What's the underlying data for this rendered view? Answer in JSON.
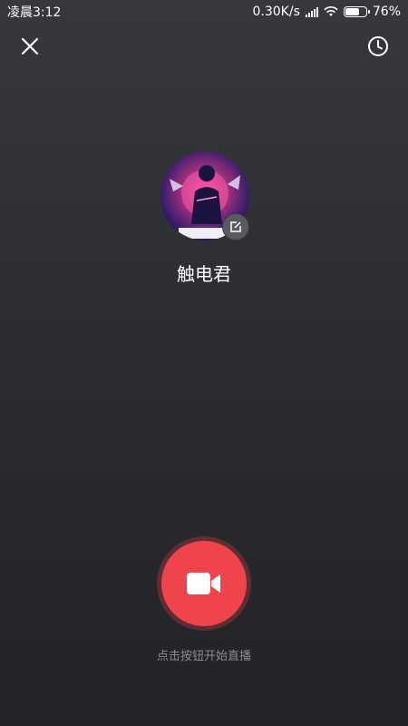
{
  "status_bar": {
    "time": "凌晨3:12",
    "net_speed": "0.30K/s",
    "battery_percent": "76%",
    "battery_level": 0.76,
    "icons": [
      "signal-icon",
      "wifi-icon",
      "battery-icon"
    ]
  },
  "header": {
    "close_icon": "close-icon",
    "history_icon": "history-clock-icon"
  },
  "profile": {
    "avatar": "avatar-image",
    "edit_icon": "edit-icon",
    "name": "触电君"
  },
  "live": {
    "button_icon": "video-camera-icon",
    "hint": "点击按钮开始直播",
    "accent_color": "#f0444c"
  }
}
